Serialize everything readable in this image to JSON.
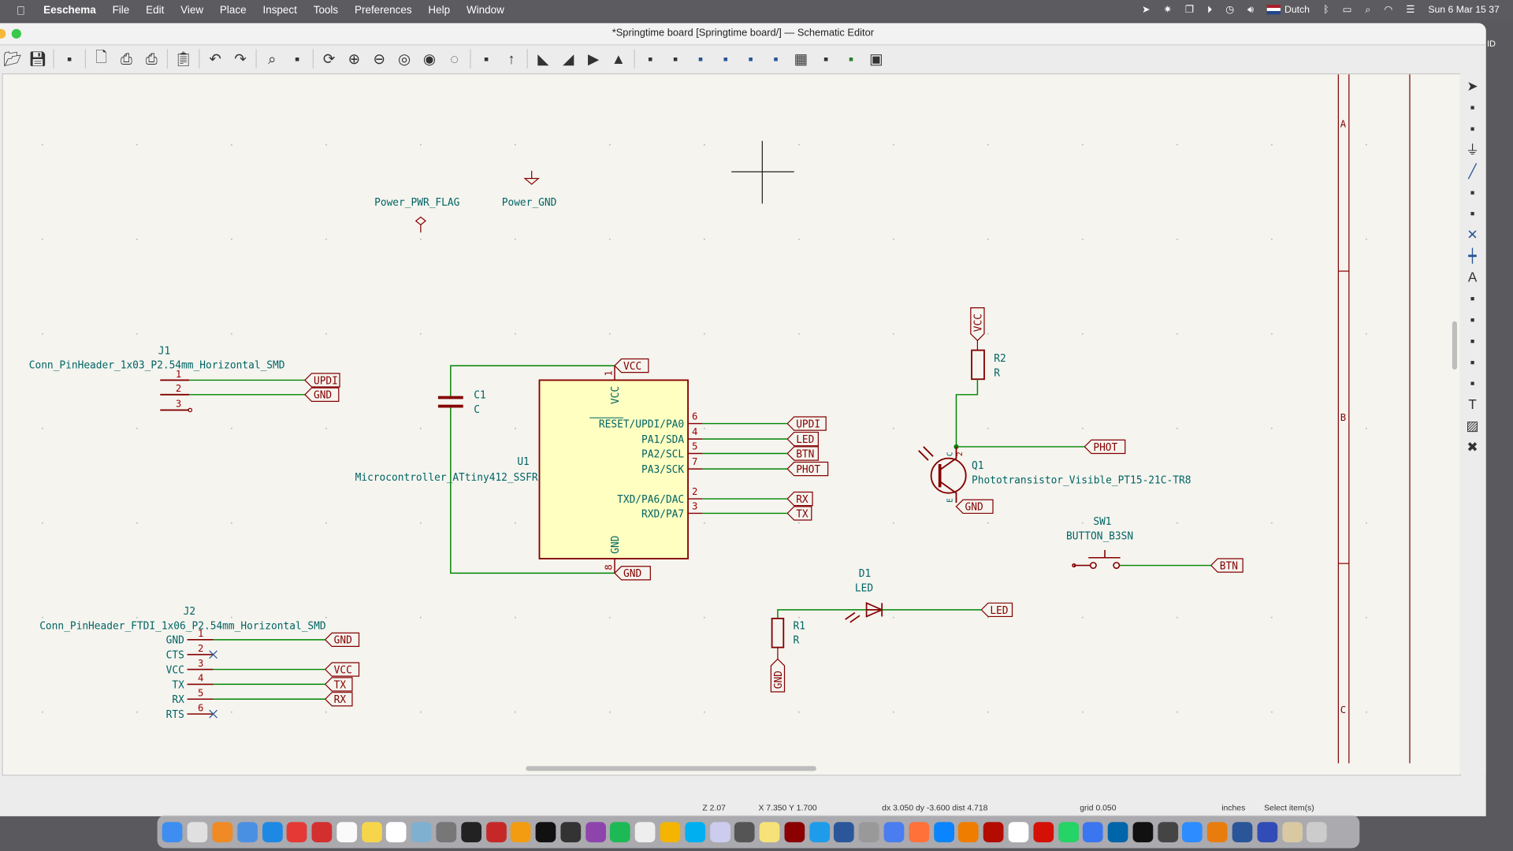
{
  "menubar": {
    "app_name": "Eeschema",
    "menus": [
      "File",
      "Edit",
      "View",
      "Place",
      "Inspect",
      "Tools",
      "Preferences",
      "Help",
      "Window"
    ],
    "input_language": "Dutch",
    "clock": "Sun 6 Mar  15 37"
  },
  "window": {
    "title": "*Springtime board [Springtime board/] — Schematic Editor"
  },
  "toolbar": {
    "icons": [
      "open-icon",
      "save-icon",
      "schematic-setup-icon",
      "page-settings-icon",
      "print-icon",
      "plot-icon",
      "paste-icon",
      "undo-icon",
      "redo-icon",
      "find-icon",
      "find-replace-icon",
      "refresh-icon",
      "zoom-in-icon",
      "zoom-out-icon",
      "zoom-fit-icon",
      "zoom-objects-icon",
      "zoom-selection-icon",
      "hierarchy-navigator-icon",
      "leave-sheet-icon",
      "rotate-ccw-icon",
      "rotate-cw-icon",
      "mirror-v-icon",
      "mirror-h-icon",
      "symbol-editor-icon",
      "symbol-browser-icon",
      "footprint-editor-icon",
      "annotate-icon",
      "erc-icon",
      "assign-footprints-icon",
      "bom-icon",
      "update-pcb-icon",
      "pcbnew-icon",
      "scripting-console-icon"
    ]
  },
  "right_toolbar": {
    "icons": [
      "select-icon",
      "highlight-net-icon",
      "add-symbol-icon",
      "add-power-icon",
      "add-wire-icon",
      "add-bus-icon",
      "bus-entry-icon",
      "no-connect-icon",
      "junction-icon",
      "net-label-icon",
      "global-label-icon",
      "hierarchical-label-icon",
      "add-sheet-icon",
      "import-sheet-pin-icon",
      "graphic-line-icon",
      "add-text-icon",
      "add-image-icon",
      "delete-icon"
    ]
  },
  "schematic": {
    "power_flag": "Power_PWR_FLAG",
    "power_gnd": "Power_GND",
    "j1": {
      "ref": "J1",
      "value": "Conn_PinHeader_1x03_P2.54mm_Horizontal_SMD",
      "pins": [
        "1",
        "2",
        "3"
      ],
      "labels": [
        "UPDI",
        "GND"
      ]
    },
    "c1": {
      "ref": "C1",
      "value": "C"
    },
    "u1": {
      "ref": "U1",
      "value": "Microcontroller_ATtiny412_SSFR",
      "vcc_pin": {
        "num": "1",
        "name": "VCC",
        "label": "VCC"
      },
      "gnd_pin": {
        "num": "8",
        "name": "GND",
        "label": "GND"
      },
      "pins": [
        {
          "num": "6",
          "name": "RESET/UPDI/PA0",
          "label": "UPDI"
        },
        {
          "num": "4",
          "name": "PA1/SDA",
          "label": "LED"
        },
        {
          "num": "5",
          "name": "PA2/SCL",
          "label": "BTN"
        },
        {
          "num": "7",
          "name": "PA3/SCK",
          "label": "PHOT"
        },
        {
          "num": "2",
          "name": "TXD/PA6/DAC",
          "label": "RX"
        },
        {
          "num": "3",
          "name": "RXD/PA7",
          "label": "TX"
        }
      ]
    },
    "r2": {
      "ref": "R2",
      "value": "R",
      "label": "VCC"
    },
    "q1": {
      "ref": "Q1",
      "value": "Phototransistor_Visible_PT15-21C-TR8",
      "c": "C",
      "e": "E",
      "pin_c": "2",
      "pin_e": "1",
      "label_c": "PHOT",
      "label_e": "GND"
    },
    "sw1": {
      "ref": "SW1",
      "value": "BUTTON_B3SN",
      "label": "BTN"
    },
    "d1": {
      "ref": "D1",
      "value": "LED",
      "label": "LED"
    },
    "r1": {
      "ref": "R1",
      "value": "R",
      "label": "GND"
    },
    "j2": {
      "ref": "J2",
      "value": "Conn_PinHeader_FTDI_1x06_P2.54mm_Horizontal_SMD",
      "pins": [
        {
          "num": "1",
          "name": "GND",
          "label": "GND"
        },
        {
          "num": "2",
          "name": "CTS",
          "label": ""
        },
        {
          "num": "3",
          "name": "VCC",
          "label": "VCC"
        },
        {
          "num": "4",
          "name": "TX",
          "label": "TX"
        },
        {
          "num": "5",
          "name": "RX",
          "label": "RX"
        },
        {
          "num": "6",
          "name": "RTS",
          "label": ""
        }
      ]
    },
    "frame_rows": [
      "A",
      "B",
      "C"
    ]
  },
  "status": {
    "zoom": "Z 2.07",
    "cursor": "X 7.350  Y 1.700",
    "delta": "dx 3.050  dy -3.600  dist 4.718",
    "grid": "grid 0.050",
    "units": "inches",
    "mode": "Select item(s)"
  },
  "dock": {
    "apps": [
      "finder",
      "launchpad",
      "vlc",
      "mail",
      "safari",
      "chrome",
      "vivaldi",
      "reminders",
      "notes",
      "calendar",
      "preview",
      "calculator",
      "terminal-app",
      "bear",
      "pages",
      "ia-writer",
      "garageband",
      "podcasts",
      "spotify",
      "scrivener",
      "photos",
      "skype",
      "xcode-tool",
      "utility",
      "stickies",
      "bbedit",
      "flow",
      "word",
      "sketchup",
      "news",
      "firefox",
      "edge",
      "books",
      "acrobat",
      "slack",
      "lastfm",
      "whatsapp",
      "signal",
      "vscode",
      "terminal",
      "system-monitor",
      "zoom",
      "blender",
      "settings",
      "kicad",
      "pcb-calculator",
      "trash"
    ]
  },
  "colors": {
    "wire": "#008400",
    "component": "#840000",
    "text": "#006464",
    "body": "#ffffc2",
    "canvas": "#f5f4ef"
  }
}
